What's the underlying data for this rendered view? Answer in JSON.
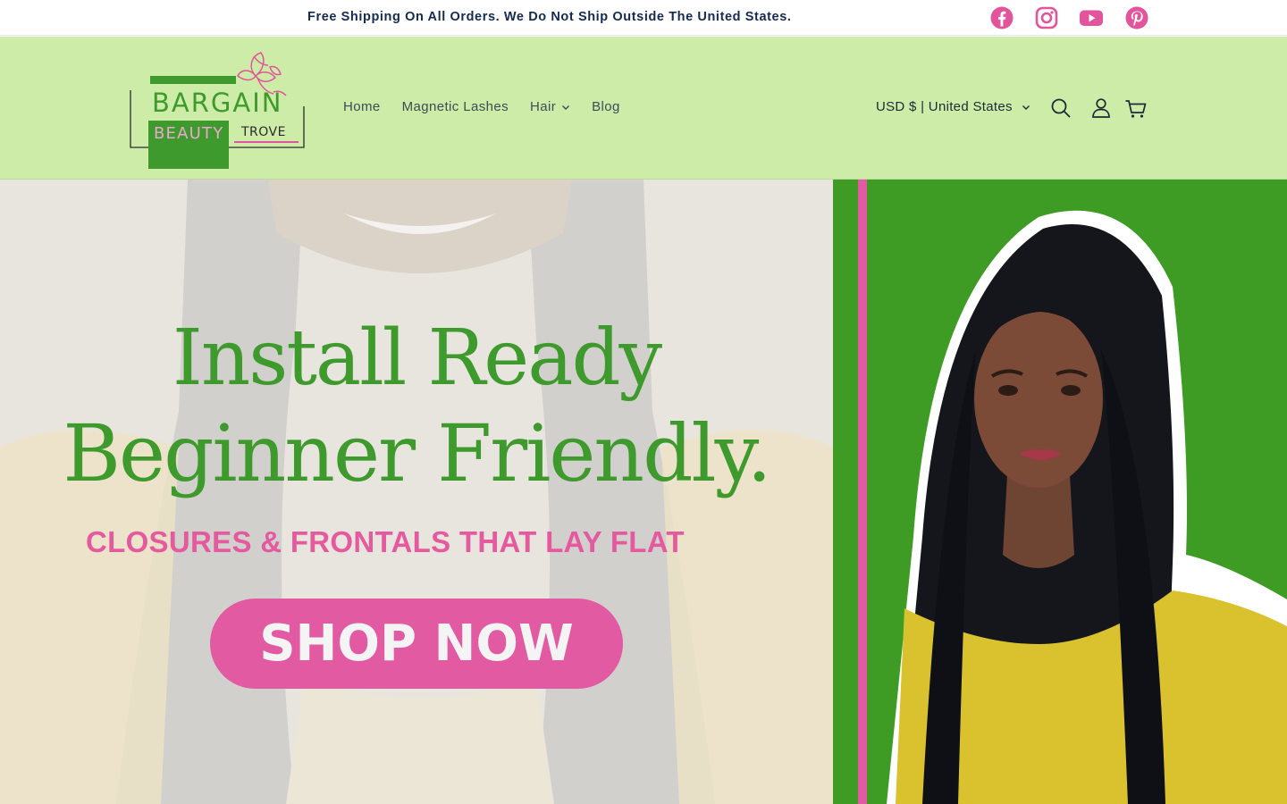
{
  "announcement": {
    "text": "Free Shipping On All Orders. We Do Not Ship Outside The United States."
  },
  "social": [
    {
      "name": "facebook-icon",
      "color": "#e2559c"
    },
    {
      "name": "instagram-icon",
      "color": "#e2559c"
    },
    {
      "name": "youtube-icon",
      "color": "#e2559c"
    },
    {
      "name": "pinterest-icon",
      "color": "#e2559c"
    }
  ],
  "logo": {
    "line1": "BARGAIN",
    "line2": "BEAUTY",
    "line3": "TROVE"
  },
  "nav": {
    "items": [
      {
        "label": "Home"
      },
      {
        "label": "Magnetic Lashes"
      },
      {
        "label": "Hair",
        "has_dropdown": true
      },
      {
        "label": "Blog"
      }
    ]
  },
  "header": {
    "currency": "USD $ | United States",
    "icons": [
      "search-icon",
      "account-icon",
      "cart-icon"
    ],
    "background": "#cdeca8"
  },
  "hero": {
    "headline_line1": "Install Ready",
    "headline_line2": "Beginner Friendly.",
    "subheadline": "CLOSURES & FRONTALS THAT LAY FLAT",
    "cta_label": "SHOP NOW",
    "colors": {
      "headline": "#3f9a2d",
      "accent": "#e25aa2",
      "panel": "#3e9c24"
    }
  }
}
